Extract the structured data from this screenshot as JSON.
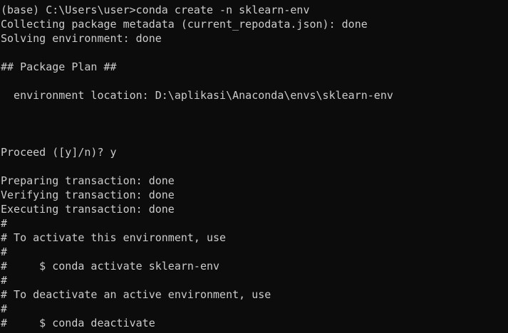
{
  "console": {
    "lines": [
      "(base) C:\\Users\\user>conda create -n sklearn-env",
      "Collecting package metadata (current_repodata.json): done",
      "Solving environment: done",
      "",
      "## Package Plan ##",
      "",
      "  environment location: D:\\aplikasi\\Anaconda\\envs\\sklearn-env",
      "",
      "",
      "",
      "Proceed ([y]/n)? y",
      "",
      "Preparing transaction: done",
      "Verifying transaction: done",
      "Executing transaction: done",
      "#",
      "# To activate this environment, use",
      "#",
      "#     $ conda activate sklearn-env",
      "#",
      "# To deactivate an active environment, use",
      "#",
      "#     $ conda deactivate"
    ],
    "colors": {
      "background": "#0c0c0c",
      "text": "#cccccc"
    }
  }
}
